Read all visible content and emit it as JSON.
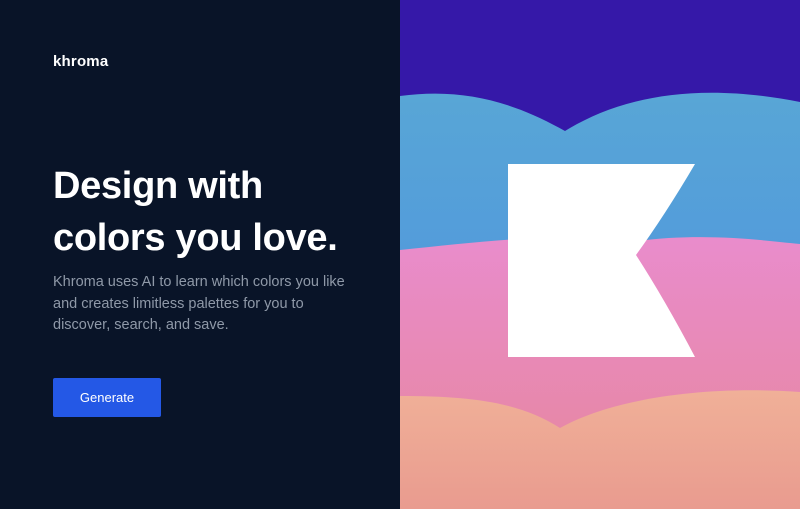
{
  "brand": {
    "logo_text": "khroma"
  },
  "hero": {
    "headline_line1": "Design with",
    "headline_line2": "colors you love.",
    "description_line1": "Khroma uses AI to learn which colors you like",
    "description_line2": "and creates limitless palettes for you to",
    "description_line3": "discover, search, and save.",
    "generate_label": "Generate"
  },
  "colors": {
    "left_background": "#091428",
    "description_text": "#8f99a8",
    "button_background": "#2458e6",
    "wave_purple": "#3518a8",
    "wave_blue": "#4e9ad8",
    "wave_pink": "#e68bc5",
    "wave_peach": "#eea68e",
    "logo_mark": "#ffffff"
  }
}
